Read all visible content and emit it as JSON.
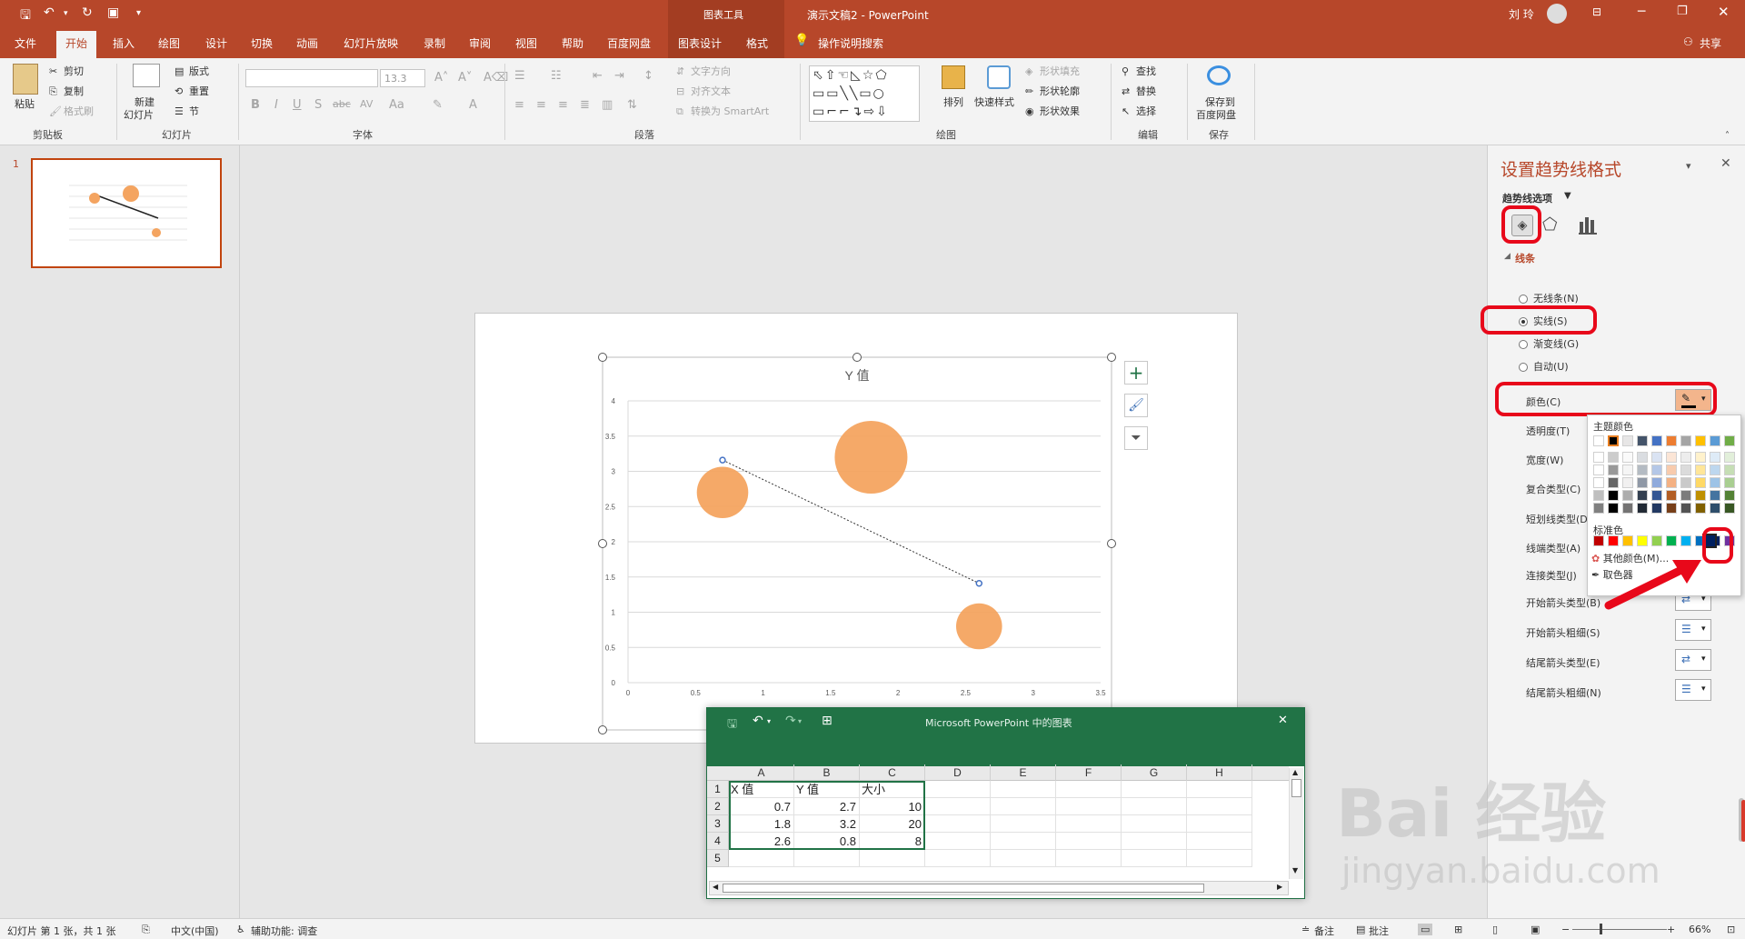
{
  "titlebar": {
    "context_tab": "图表工具",
    "doc_title": "演示文稿2  -  PowerPoint",
    "user": "刘 玲",
    "accent": "#b7472a"
  },
  "tabs": [
    "文件",
    "开始",
    "插入",
    "绘图",
    "设计",
    "切换",
    "动画",
    "幻灯片放映",
    "录制",
    "审阅",
    "视图",
    "帮助",
    "百度网盘",
    "图表设计",
    "格式"
  ],
  "tell_me": "操作说明搜索",
  "share": "共享",
  "ribbon": {
    "clipboard": {
      "paste": "粘贴",
      "cut": "剪切",
      "copy": "复制",
      "format_painter": "格式刷",
      "label": "剪贴板"
    },
    "slides": {
      "new_slide_1": "新建",
      "new_slide_2": "幻灯片",
      "layout": "版式",
      "reset": "重置",
      "section": "节",
      "label": "幻灯片"
    },
    "font": {
      "size": "13.3",
      "label": "字体"
    },
    "paragraph": {
      "text_direction": "文字方向",
      "align_text": "对齐文本",
      "smartart": "转换为 SmartArt",
      "label": "段落"
    },
    "drawing": {
      "arrange": "排列",
      "quick_styles": "快速样式",
      "shape_fill": "形状填充",
      "shape_outline": "形状轮廓",
      "shape_effects": "形状效果",
      "label": "绘图"
    },
    "editing": {
      "find": "查找",
      "replace": "替换",
      "select": "选择",
      "label": "编辑"
    },
    "save": {
      "save_1": "保存到",
      "save_2": "百度网盘",
      "label": "保存"
    }
  },
  "thumbnail": {
    "number": "1"
  },
  "chart_data": {
    "type": "scatter",
    "title": "Y 值",
    "xlim": [
      0,
      3.5
    ],
    "ylim": [
      0,
      4
    ],
    "x_ticks": [
      "0",
      "0.5",
      "1",
      "1.5",
      "2",
      "2.5",
      "3",
      "3.5"
    ],
    "y_ticks": [
      "0",
      "0.5",
      "1",
      "1.5",
      "2",
      "2.5",
      "3",
      "3.5",
      "4"
    ],
    "points": [
      {
        "x": 0.7,
        "y": 2.7,
        "size": 10
      },
      {
        "x": 1.8,
        "y": 3.2,
        "size": 20
      },
      {
        "x": 2.6,
        "y": 0.8,
        "size": 8
      }
    ],
    "trendline": {
      "x": [
        0.7,
        2.6
      ],
      "y": [
        3.16,
        1.41
      ]
    },
    "bubble_color": "#f4a460",
    "trend_color": "#4472c4",
    "grid": true
  },
  "format_pane": {
    "title": "设置趋势线格式",
    "options_label": "趋势线选项",
    "section": "线条",
    "radios": [
      {
        "label": "无线条(N)",
        "checked": false
      },
      {
        "label": "实线(S)",
        "checked": true
      },
      {
        "label": "渐变线(G)",
        "checked": false
      },
      {
        "label": "自动(U)",
        "checked": false
      }
    ],
    "color_label": "颜色(C)",
    "rows": [
      "透明度(T)",
      "宽度(W)",
      "复合类型(C)",
      "短划线类型(D)",
      "线端类型(A)",
      "连接类型(J)",
      "开始箭头类型(B)",
      "开始箭头粗细(S)",
      "结尾箭头类型(E)",
      "结尾箭头粗细(N)"
    ]
  },
  "color_popup": {
    "theme_label": "主题颜色",
    "standard_label": "标准色",
    "more_colors": "其他颜色(M)...",
    "eyedropper": "取色器",
    "theme_top": [
      "#ffffff",
      "#000000",
      "#e7e6e6",
      "#44546a",
      "#4472c4",
      "#ed7d31",
      "#a5a5a5",
      "#ffc000",
      "#5b9bd5",
      "#70ad47"
    ],
    "standard": [
      "#c00000",
      "#ff0000",
      "#ffc000",
      "#ffff00",
      "#92d050",
      "#00b050",
      "#00b0f0",
      "#0070c0",
      "#002060",
      "#7030a0"
    ]
  },
  "excel": {
    "title": "Microsoft PowerPoint 中的图表",
    "columns": [
      "A",
      "B",
      "C",
      "D",
      "E",
      "F",
      "G",
      "H"
    ],
    "rows": [
      "1",
      "2",
      "3",
      "4",
      "5"
    ],
    "header": [
      "X 值",
      "Y 值",
      "大小"
    ],
    "data": [
      [
        "0.7",
        "2.7",
        "10"
      ],
      [
        "1.8",
        "3.2",
        "20"
      ],
      [
        "2.6",
        "0.8",
        "8"
      ]
    ]
  },
  "statusbar": {
    "slide_info": "幻灯片 第 1 张，共 1 张",
    "language": "中文(中国)",
    "accessibility": "辅助功能: 调查",
    "notes": "备注",
    "comments": "批注",
    "zoom": "66%"
  },
  "watermark": {
    "brand": "Bai  经验",
    "url": "jingyan.baidu.com"
  }
}
